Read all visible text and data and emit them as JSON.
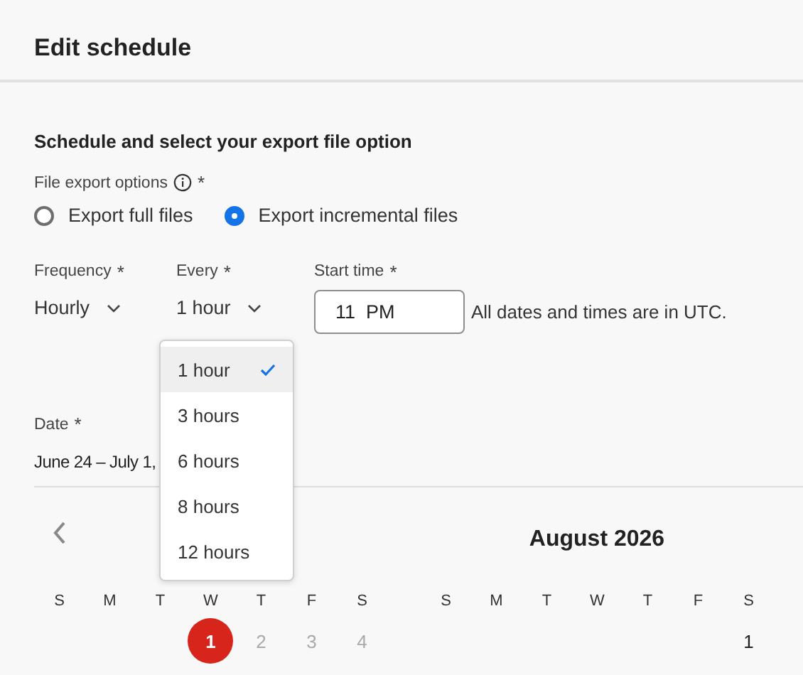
{
  "title": "Edit schedule",
  "section_title": "Schedule and select your export file option",
  "file_export": {
    "label": "File export options",
    "required_mark": "*",
    "options": [
      {
        "label": "Export full files",
        "selected": false
      },
      {
        "label": "Export incremental files",
        "selected": true
      }
    ]
  },
  "frequency": {
    "label": "Frequency",
    "required_mark": "*",
    "value": "Hourly"
  },
  "every": {
    "label": "Every",
    "required_mark": "*",
    "value": "1 hour",
    "expanded": true,
    "options": [
      {
        "label": "1 hour",
        "selected": true
      },
      {
        "label": "3 hours",
        "selected": false
      },
      {
        "label": "6 hours",
        "selected": false
      },
      {
        "label": "8 hours",
        "selected": false
      },
      {
        "label": "12 hours",
        "selected": false
      }
    ]
  },
  "start_time": {
    "label": "Start time",
    "required_mark": "*",
    "value": "11  PM"
  },
  "timezone_note": "All dates and times are in UTC.",
  "date": {
    "label": "Date",
    "required_mark": "*",
    "value": "June 24 – July 1,"
  },
  "calendar": {
    "months": [
      {
        "weekdays": [
          "S",
          "M",
          "T",
          "W",
          "T",
          "F",
          "S"
        ],
        "days": [
          {
            "kind": "blank"
          },
          {
            "kind": "blank"
          },
          {
            "kind": "blank"
          },
          {
            "kind": "day",
            "label": "1",
            "selected": true,
            "disabled": false
          },
          {
            "kind": "day",
            "label": "2",
            "selected": false,
            "disabled": true
          },
          {
            "kind": "day",
            "label": "3",
            "selected": false,
            "disabled": true
          },
          {
            "kind": "day",
            "label": "4",
            "selected": false,
            "disabled": true
          }
        ]
      },
      {
        "title": "August 2026",
        "weekdays": [
          "S",
          "M",
          "T",
          "W",
          "T",
          "F",
          "S"
        ],
        "days": [
          {
            "kind": "blank"
          },
          {
            "kind": "blank"
          },
          {
            "kind": "blank"
          },
          {
            "kind": "blank"
          },
          {
            "kind": "blank"
          },
          {
            "kind": "blank"
          },
          {
            "kind": "day",
            "label": "1",
            "selected": false,
            "disabled": false
          }
        ]
      }
    ]
  }
}
